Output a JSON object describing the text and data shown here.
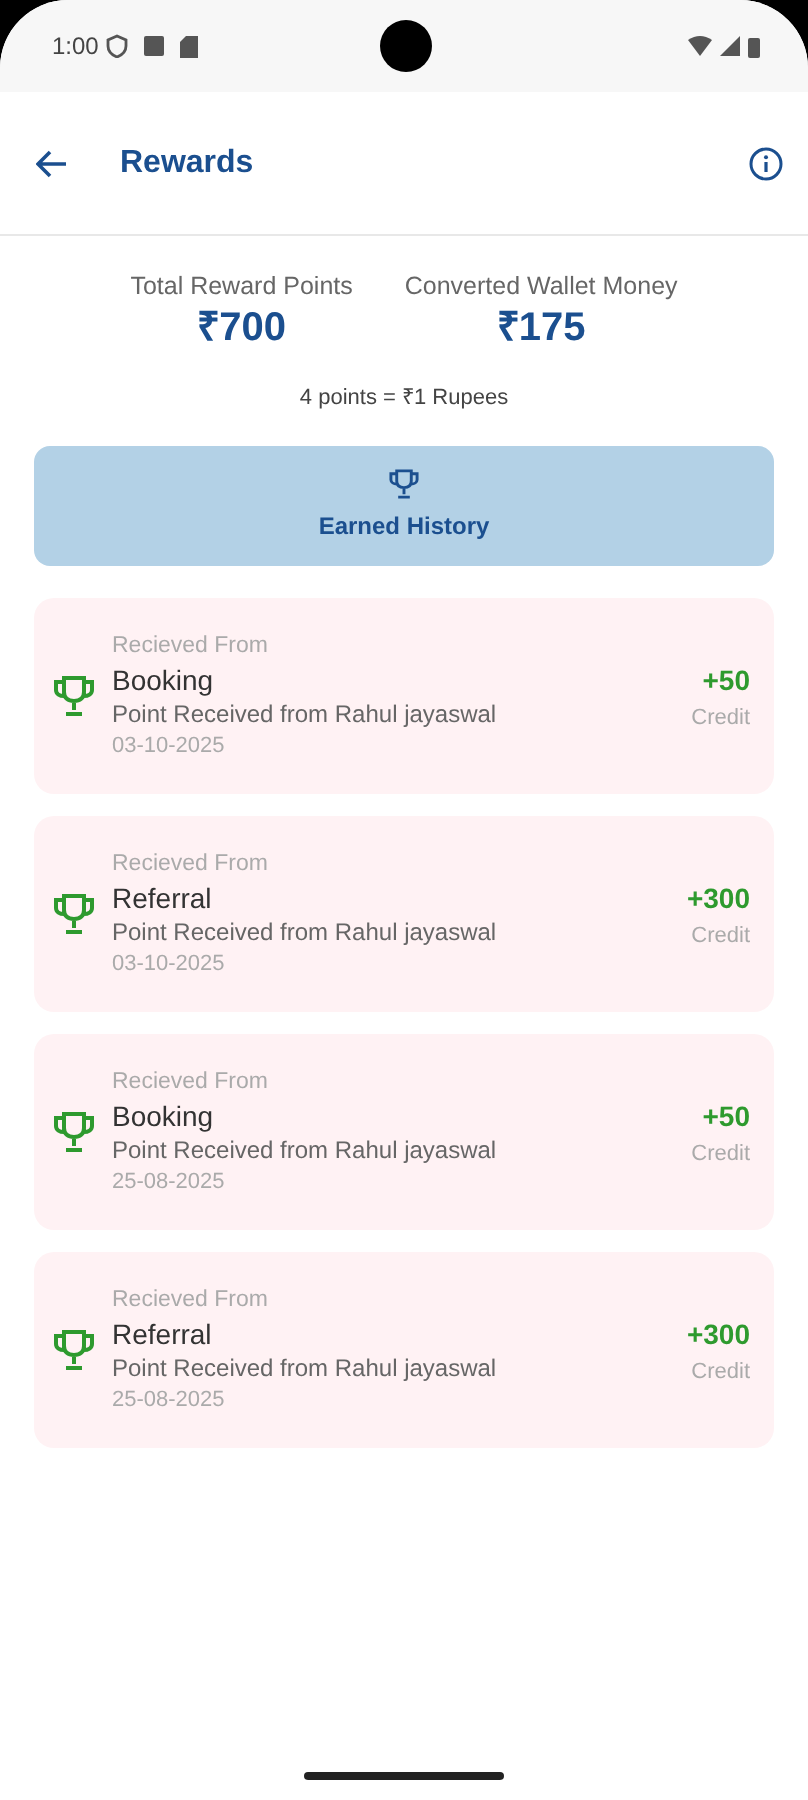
{
  "status_bar": {
    "time": "1:00"
  },
  "app_bar": {
    "title": "Rewards"
  },
  "summary": [
    {
      "label": "Total Reward Points",
      "value": "₹700"
    },
    {
      "label": "Converted Wallet Money",
      "value": "₹175"
    }
  ],
  "conversion_note": "4 points = ₹1 Rupees",
  "history_tab": {
    "label": "Earned History",
    "selected": true
  },
  "transactions": [
    {
      "caption": "Recieved From",
      "source": "Booking",
      "description": "Point Received from Rahul jayaswal",
      "date": "03-10-2025",
      "amount": "+50",
      "type": "Credit"
    },
    {
      "caption": "Recieved From",
      "source": "Referral",
      "description": "Point Received from Rahul jayaswal",
      "date": "03-10-2025",
      "amount": "+300",
      "type": "Credit"
    },
    {
      "caption": "Recieved From",
      "source": "Booking",
      "description": "Point Received from Rahul jayaswal",
      "date": "25-08-2025",
      "amount": "+50",
      "type": "Credit"
    },
    {
      "caption": "Recieved From",
      "source": "Referral",
      "description": "Point Received from Rahul jayaswal",
      "date": "25-08-2025",
      "amount": "+300",
      "type": "Credit"
    }
  ]
}
